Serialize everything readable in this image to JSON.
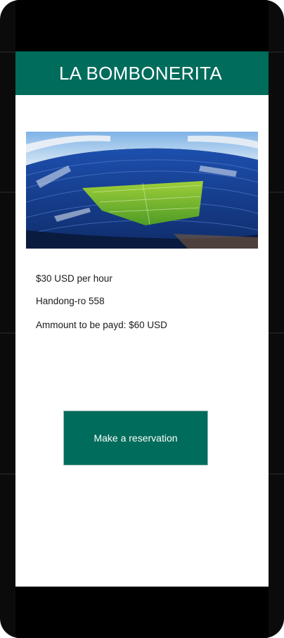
{
  "header": {
    "title": "LA BOMBONERITA"
  },
  "venue": {
    "image": "stadium-photo",
    "price": "$30 USD per hour",
    "address": "Handong-ro 558",
    "amount": "Ammount to be payd: $60 USD"
  },
  "actions": {
    "reserve_label": "Make a reservation"
  },
  "colors": {
    "brand": "#006c5b",
    "screen_bg": "#ffffff",
    "frame": "#0b0b0b"
  }
}
